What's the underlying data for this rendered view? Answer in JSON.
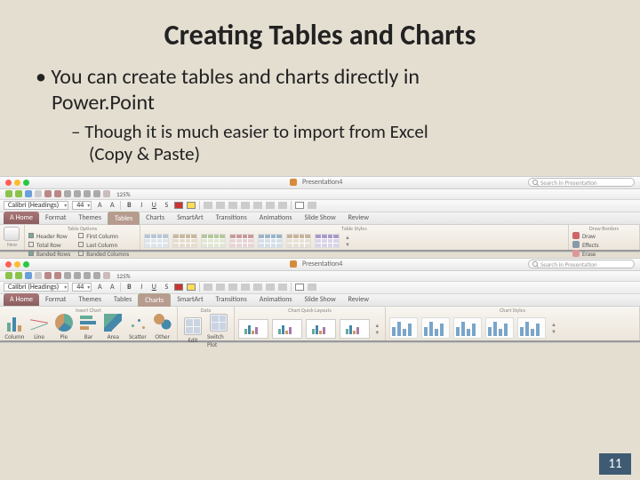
{
  "slide": {
    "title": "Creating Tables and Charts",
    "bullet1_line1": "You can create tables and charts directly in",
    "bullet1_line2": "Power.Point",
    "bullet2_line1": "Though it is much easier to import from Excel",
    "bullet2_line2": "(Copy & Paste)",
    "page_number": "11"
  },
  "shot1": {
    "window_title": "Presentation4",
    "search_placeholder": "Search in Presentation",
    "zoom": "125%",
    "font_name": "Calibri (Headings)",
    "font_size": "44",
    "tabs": [
      "A Home",
      "Format",
      "Themes",
      "Tables",
      "Charts",
      "SmartArt",
      "Transitions",
      "Animations",
      "Slide Show",
      "Review"
    ],
    "groups": {
      "new": "New",
      "table_options": "Table Options",
      "opt_header_row": "Header Row",
      "opt_total_row": "Total Row",
      "opt_banded_rows": "Banded Rows",
      "opt_first_col": "First Column",
      "opt_last_col": "Last Column",
      "opt_banded_cols": "Banded Columns",
      "table_styles": "Table Styles",
      "draw_borders": "Draw Borders",
      "draw": "Draw",
      "effects": "Effects",
      "erase": "Erase"
    }
  },
  "shot2": {
    "window_title": "Presentation4",
    "search_placeholder": "Search in Presentation",
    "zoom": "125%",
    "font_name": "Calibri (Headings)",
    "font_size": "44",
    "tabs": [
      "A Home",
      "Format",
      "Themes",
      "Tables",
      "Charts",
      "SmartArt",
      "Transitions",
      "Animations",
      "Slide Show",
      "Review"
    ],
    "groups": {
      "insert_chart": "Insert Chart",
      "column": "Column",
      "line": "Line",
      "pie": "Pie",
      "bar": "Bar",
      "area": "Area",
      "scatter": "Scatter",
      "other": "Other",
      "data": "Data",
      "edit": "Edit",
      "switch_plot": "Switch Plot",
      "quick_layouts": "Chart Quick Layouts",
      "chart_styles": "Chart Styles"
    }
  }
}
